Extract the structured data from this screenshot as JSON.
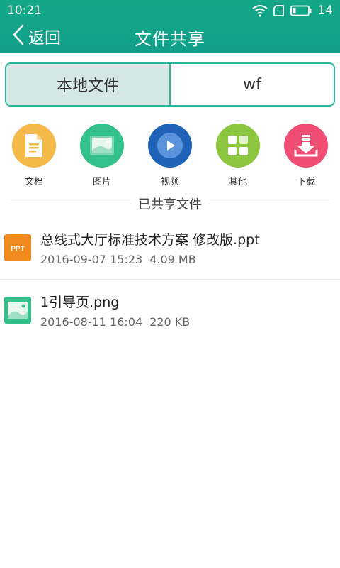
{
  "status_bar": {
    "time": "10:21",
    "battery": "14"
  },
  "nav": {
    "back_label": "返回",
    "title": "文件共享"
  },
  "tabs": [
    {
      "label": "本地文件",
      "active": true
    },
    {
      "label": "wf",
      "active": false
    }
  ],
  "categories": [
    {
      "label": "文档",
      "icon": "document-icon",
      "color": "#f5b94a"
    },
    {
      "label": "图片",
      "icon": "image-icon",
      "color": "#33c08a"
    },
    {
      "label": "视频",
      "icon": "video-icon",
      "color": "#1f62b8"
    },
    {
      "label": "其他",
      "icon": "grid-icon",
      "color": "#8cc63f"
    },
    {
      "label": "下载",
      "icon": "download-icon",
      "color": "#ef4d74"
    }
  ],
  "shared_section_title": "已共享文件",
  "files": [
    {
      "name": "总线式大厅标准技术方案 修改版.ppt",
      "date": "2016-09-07 15:23",
      "size": "4.09 MB",
      "icon": "ppt-file-icon",
      "icon_text": "PPT",
      "icon_color": "#f08a1c"
    },
    {
      "name": "1引导页.png",
      "date": "2016-08-11 16:04",
      "size": "220 KB",
      "icon": "image-file-icon",
      "icon_color": "#33c08a"
    }
  ]
}
